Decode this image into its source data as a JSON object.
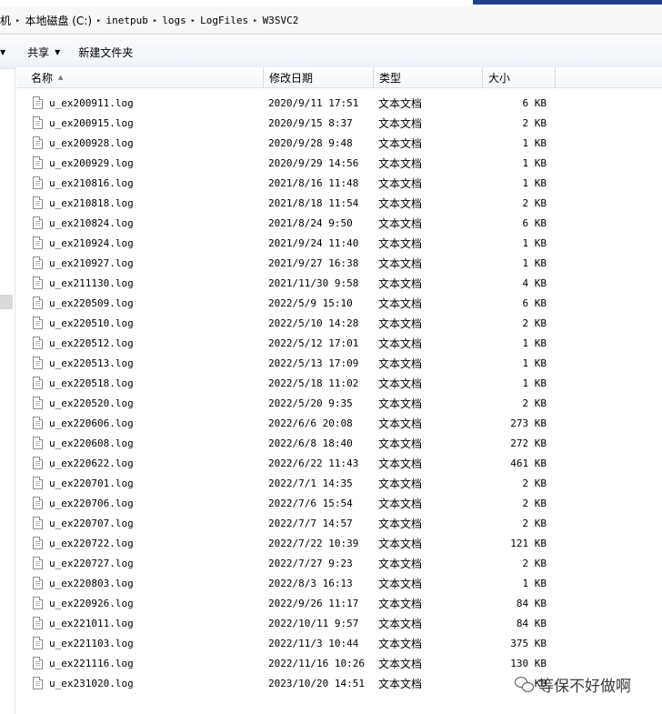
{
  "address": {
    "partial_left": "机",
    "breadcrumbs": [
      "本地磁盘 (C:)",
      "inetpub",
      "logs",
      "LogFiles",
      "W3SVC2"
    ]
  },
  "toolbar": {
    "share_label": "共享",
    "new_folder_label": "新建文件夹"
  },
  "columns": {
    "name": "名称",
    "date": "修改日期",
    "type": "类型",
    "size": "大小"
  },
  "files": [
    {
      "name": "u_ex200911.log",
      "date": "2020/9/11 17:51",
      "type": "文本文档",
      "size": "6 KB"
    },
    {
      "name": "u_ex200915.log",
      "date": "2020/9/15 8:37",
      "type": "文本文档",
      "size": "2 KB"
    },
    {
      "name": "u_ex200928.log",
      "date": "2020/9/28 9:48",
      "type": "文本文档",
      "size": "1 KB"
    },
    {
      "name": "u_ex200929.log",
      "date": "2020/9/29 14:56",
      "type": "文本文档",
      "size": "1 KB"
    },
    {
      "name": "u_ex210816.log",
      "date": "2021/8/16 11:48",
      "type": "文本文档",
      "size": "1 KB"
    },
    {
      "name": "u_ex210818.log",
      "date": "2021/8/18 11:54",
      "type": "文本文档",
      "size": "2 KB"
    },
    {
      "name": "u_ex210824.log",
      "date": "2021/8/24 9:50",
      "type": "文本文档",
      "size": "6 KB"
    },
    {
      "name": "u_ex210924.log",
      "date": "2021/9/24 11:40",
      "type": "文本文档",
      "size": "1 KB"
    },
    {
      "name": "u_ex210927.log",
      "date": "2021/9/27 16:38",
      "type": "文本文档",
      "size": "1 KB"
    },
    {
      "name": "u_ex211130.log",
      "date": "2021/11/30 9:58",
      "type": "文本文档",
      "size": "4 KB"
    },
    {
      "name": "u_ex220509.log",
      "date": "2022/5/9 15:10",
      "type": "文本文档",
      "size": "6 KB"
    },
    {
      "name": "u_ex220510.log",
      "date": "2022/5/10 14:28",
      "type": "文本文档",
      "size": "2 KB"
    },
    {
      "name": "u_ex220512.log",
      "date": "2022/5/12 17:01",
      "type": "文本文档",
      "size": "1 KB"
    },
    {
      "name": "u_ex220513.log",
      "date": "2022/5/13 17:09",
      "type": "文本文档",
      "size": "1 KB"
    },
    {
      "name": "u_ex220518.log",
      "date": "2022/5/18 11:02",
      "type": "文本文档",
      "size": "1 KB"
    },
    {
      "name": "u_ex220520.log",
      "date": "2022/5/20 9:35",
      "type": "文本文档",
      "size": "2 KB"
    },
    {
      "name": "u_ex220606.log",
      "date": "2022/6/6 20:08",
      "type": "文本文档",
      "size": "273 KB"
    },
    {
      "name": "u_ex220608.log",
      "date": "2022/6/8 18:40",
      "type": "文本文档",
      "size": "272 KB"
    },
    {
      "name": "u_ex220622.log",
      "date": "2022/6/22 11:43",
      "type": "文本文档",
      "size": "461 KB"
    },
    {
      "name": "u_ex220701.log",
      "date": "2022/7/1 14:35",
      "type": "文本文档",
      "size": "2 KB"
    },
    {
      "name": "u_ex220706.log",
      "date": "2022/7/6 15:54",
      "type": "文本文档",
      "size": "2 KB"
    },
    {
      "name": "u_ex220707.log",
      "date": "2022/7/7 14:57",
      "type": "文本文档",
      "size": "2 KB"
    },
    {
      "name": "u_ex220722.log",
      "date": "2022/7/22 10:39",
      "type": "文本文档",
      "size": "121 KB"
    },
    {
      "name": "u_ex220727.log",
      "date": "2022/7/27 9:23",
      "type": "文本文档",
      "size": "2 KB"
    },
    {
      "name": "u_ex220803.log",
      "date": "2022/8/3 16:13",
      "type": "文本文档",
      "size": "1 KB"
    },
    {
      "name": "u_ex220926.log",
      "date": "2022/9/26 11:17",
      "type": "文本文档",
      "size": "84 KB"
    },
    {
      "name": "u_ex221011.log",
      "date": "2022/10/11 9:57",
      "type": "文本文档",
      "size": "84 KB"
    },
    {
      "name": "u_ex221103.log",
      "date": "2022/11/3 10:44",
      "type": "文本文档",
      "size": "375 KB"
    },
    {
      "name": "u_ex221116.log",
      "date": "2022/11/16 10:26",
      "type": "文本文档",
      "size": "130 KB"
    },
    {
      "name": "u_ex231020.log",
      "date": "2023/10/20 14:51",
      "type": "文本文档",
      "size": "KB"
    }
  ],
  "watermark": {
    "text": "等保不好做啊",
    "icon": "wechat-icon"
  }
}
